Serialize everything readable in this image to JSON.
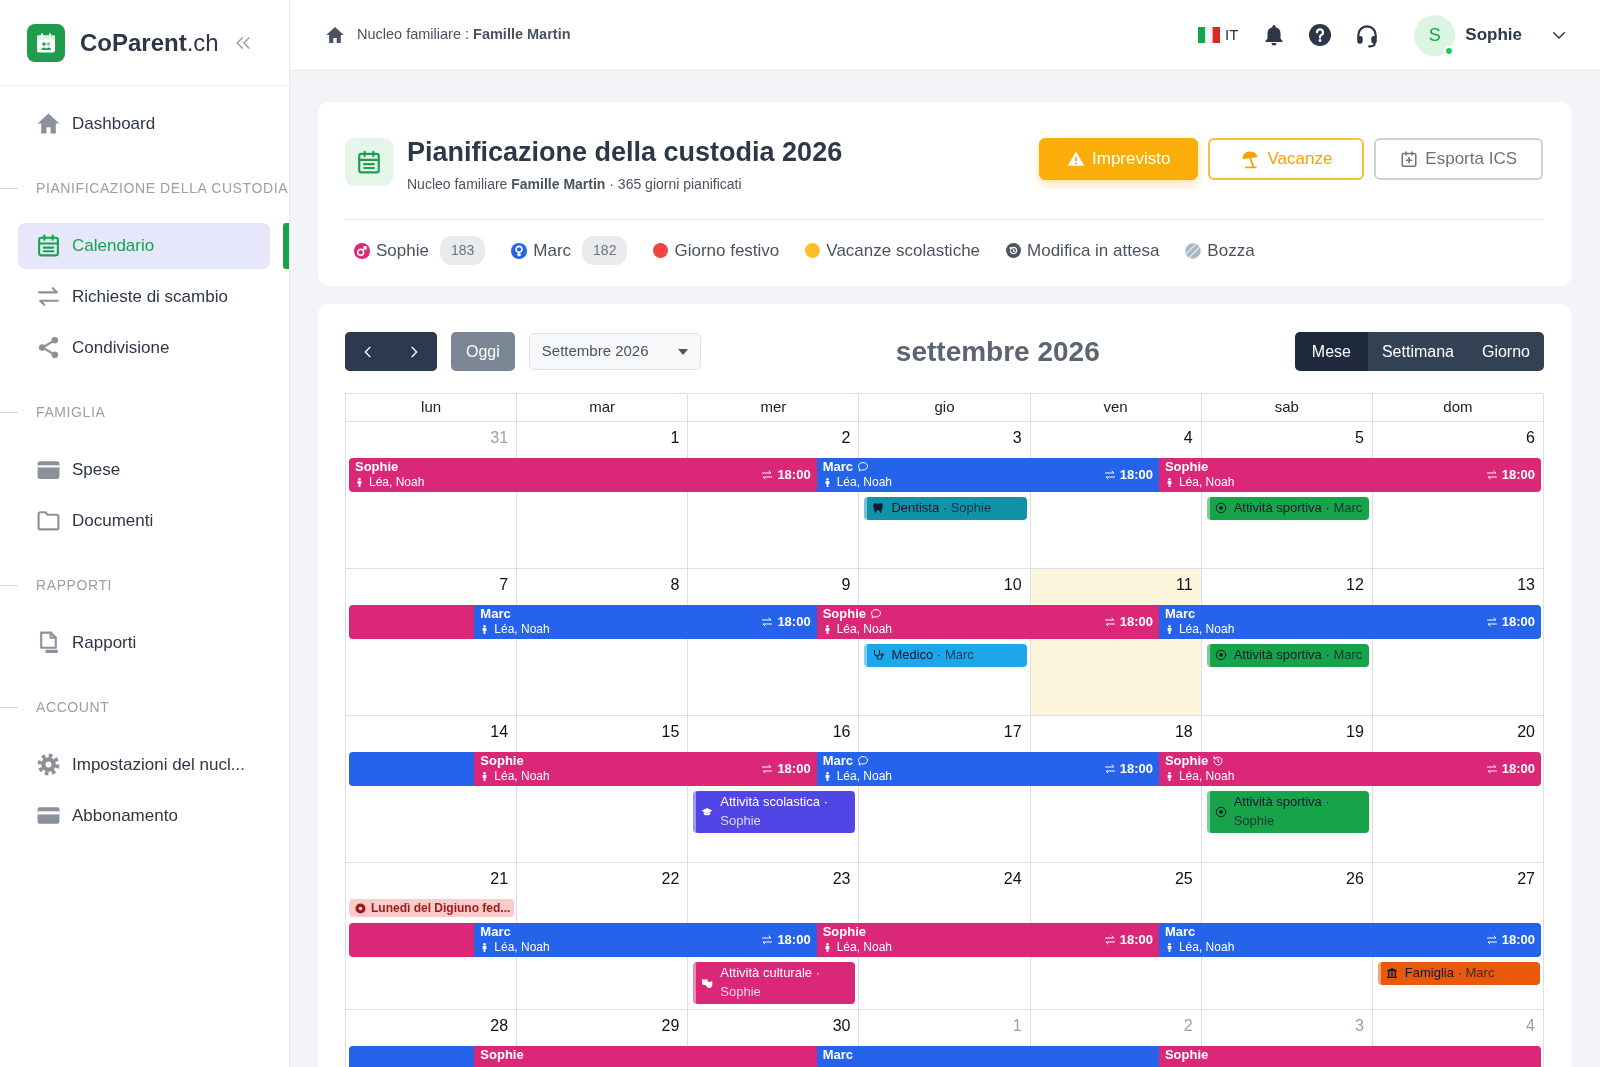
{
  "sidebar": {
    "brand": {
      "name": "CoParent",
      "suffix": ".ch"
    },
    "sections": [
      {
        "items": [
          {
            "label": "Dashboard",
            "selected": false
          }
        ]
      },
      {
        "heading": "PIANIFICAZIONE DELLA CUSTODIA",
        "items": [
          {
            "label": "Calendario",
            "selected": true
          },
          {
            "label": "Richieste di scambio",
            "selected": false
          },
          {
            "label": "Condivisione",
            "selected": false
          }
        ]
      },
      {
        "heading": "FAMIGLIA",
        "items": [
          {
            "label": "Spese",
            "selected": false
          },
          {
            "label": "Documenti",
            "selected": false
          }
        ]
      },
      {
        "heading": "RAPPORTI",
        "items": [
          {
            "label": "Rapporti",
            "selected": false
          }
        ]
      },
      {
        "heading": "ACCOUNT",
        "items": [
          {
            "label": "Impostazioni del nucl...",
            "selected": false
          },
          {
            "label": "Abbonamento",
            "selected": false
          }
        ]
      }
    ]
  },
  "topbar": {
    "breadcrumb": "Nucleo familiare : **Famille Martin**",
    "language": "IT",
    "user": {
      "initial": "S",
      "name": "Sophie",
      "online": true
    }
  },
  "header": {
    "title": "Pianificazione della custodia 2026",
    "subtitle": "Nucleo familiare **Famille Martin** · 365 giorni pianificati",
    "actions": [
      {
        "label": "Imprevisto",
        "kind": "warning"
      },
      {
        "label": "Vacanze",
        "kind": "outline-warning"
      },
      {
        "label": "Esporta ICS",
        "kind": "outline"
      }
    ],
    "legend": [
      {
        "label": "Sophie",
        "kind": "male",
        "color": "#db2777",
        "count": "183"
      },
      {
        "label": "Marc",
        "kind": "female",
        "color": "#2563eb",
        "count": "182"
      },
      {
        "label": "Giorno festivo",
        "kind": "dot",
        "color": "#ef4444"
      },
      {
        "label": "Vacanze scolastiche",
        "kind": "dot",
        "color": "#fbbf24"
      },
      {
        "label": "Modifica in attesa",
        "kind": "pending",
        "color": "#4b5563"
      },
      {
        "label": "Bozza",
        "kind": "draft",
        "color": "#a9b6c8"
      }
    ]
  },
  "calendar": {
    "month_picker": "Settembre 2026",
    "today_button": "Oggi",
    "title": "settembre 2026",
    "views": [
      {
        "label": "Mese",
        "selected": true
      },
      {
        "label": "Settimana",
        "selected": false
      },
      {
        "label": "Giorno",
        "selected": false
      }
    ],
    "weekdays": [
      "lun",
      "mar",
      "mer",
      "gio",
      "ven",
      "sab",
      "dom"
    ],
    "weeks": [
      {
        "carry": {
          "parent": "Sophie",
          "color": "#db2777",
          "children": "Léa, Noah",
          "time": "18:00",
          "note": false,
          "pending": false
        },
        "days": [
          {
            "date": "31",
            "outside": true,
            "today": false
          },
          {
            "date": "1",
            "outside": false,
            "today": false
          },
          {
            "date": "2",
            "outside": false,
            "today": false,
            "handover": {
              "parent": "Marc",
              "color": "#2563eb",
              "children": "Léa, Noah",
              "time": "18:00",
              "note": true,
              "pending": false
            }
          },
          {
            "date": "3",
            "outside": false,
            "today": false,
            "events": [
              {
                "kind": "dentist",
                "title": "Dentista ·",
                "person": "Sophie",
                "color": "#1192a9"
              }
            ]
          },
          {
            "date": "4",
            "outside": false,
            "today": false,
            "handover": {
              "parent": "Sophie",
              "color": "#db2777",
              "children": "Léa, Noah",
              "time": "18:00",
              "note": false,
              "pending": false
            }
          },
          {
            "date": "5",
            "outside": false,
            "today": false,
            "events": [
              {
                "kind": "sport",
                "title": "Attività sportiva ·",
                "person": "Marc",
                "color": "#16a34a"
              }
            ]
          },
          {
            "date": "6",
            "outside": false,
            "today": false
          }
        ]
      },
      {
        "carry": {
          "color": "#db2777"
        },
        "days": [
          {
            "date": "7",
            "outside": false,
            "today": false,
            "handover": {
              "parent": "Marc",
              "color": "#2563eb",
              "children": "Léa, Noah",
              "time": "18:00",
              "note": false,
              "pending": false
            }
          },
          {
            "date": "8",
            "outside": false,
            "today": false
          },
          {
            "date": "9",
            "outside": false,
            "today": false,
            "handover": {
              "parent": "Sophie",
              "color": "#db2777",
              "children": "Léa, Noah",
              "time": "18:00",
              "note": true,
              "pending": false
            }
          },
          {
            "date": "10",
            "outside": false,
            "today": false,
            "events": [
              {
                "kind": "medical",
                "title": "Medico ·",
                "person": "Marc",
                "color": "#1ba7e9"
              }
            ]
          },
          {
            "date": "11",
            "outside": false,
            "today": true,
            "handover": {
              "parent": "Marc",
              "color": "#2563eb",
              "children": "Léa, Noah",
              "time": "18:00",
              "note": false,
              "pending": false
            }
          },
          {
            "date": "12",
            "outside": false,
            "today": false,
            "events": [
              {
                "kind": "sport",
                "title": "Attività sportiva ·",
                "person": "Marc",
                "color": "#16a34a"
              }
            ]
          },
          {
            "date": "13",
            "outside": false,
            "today": false
          }
        ]
      },
      {
        "carry": {
          "color": "#2563eb"
        },
        "days": [
          {
            "date": "14",
            "outside": false,
            "today": false,
            "handover": {
              "parent": "Sophie",
              "color": "#db2777",
              "children": "Léa, Noah",
              "time": "18:00",
              "note": false,
              "pending": false
            }
          },
          {
            "date": "15",
            "outside": false,
            "today": false
          },
          {
            "date": "16",
            "outside": false,
            "today": false,
            "handover": {
              "parent": "Marc",
              "color": "#2563eb",
              "children": "Léa, Noah",
              "time": "18:00",
              "note": true,
              "pending": false
            },
            "events": [
              {
                "kind": "school",
                "title": "Attività scolastica ·",
                "person": "Sophie",
                "color": "#4f46e5"
              }
            ]
          },
          {
            "date": "17",
            "outside": false,
            "today": false
          },
          {
            "date": "18",
            "outside": false,
            "today": false,
            "handover": {
              "parent": "Sophie",
              "color": "#db2777",
              "children": "Léa, Noah",
              "time": "18:00",
              "note": false,
              "pending": true
            }
          },
          {
            "date": "19",
            "outside": false,
            "today": false,
            "events": [
              {
                "kind": "sport",
                "title": "Attività sportiva ·",
                "person": "Sophie",
                "color": "#16a34a"
              }
            ]
          },
          {
            "date": "20",
            "outside": false,
            "today": false
          }
        ]
      },
      {
        "carry": {
          "color": "#db2777"
        },
        "days": [
          {
            "date": "21",
            "outside": false,
            "today": false,
            "holiday": "Lunedì del Digiuno fed...",
            "handover": {
              "parent": "Marc",
              "color": "#2563eb",
              "children": "Léa, Noah",
              "time": "18:00",
              "note": false,
              "pending": false
            }
          },
          {
            "date": "22",
            "outside": false,
            "today": false
          },
          {
            "date": "23",
            "outside": false,
            "today": false,
            "handover": {
              "parent": "Sophie",
              "color": "#db2777",
              "children": "Léa, Noah",
              "time": "18:00",
              "note": false,
              "pending": false
            },
            "events": [
              {
                "kind": "culture",
                "title": "Attività culturale ·",
                "person": "Sophie",
                "color": "#db2777"
              }
            ]
          },
          {
            "date": "24",
            "outside": false,
            "today": false
          },
          {
            "date": "25",
            "outside": false,
            "today": false,
            "handover": {
              "parent": "Marc",
              "color": "#2563eb",
              "children": "Léa, Noah",
              "time": "18:00",
              "note": false,
              "pending": false
            }
          },
          {
            "date": "26",
            "outside": false,
            "today": false
          },
          {
            "date": "27",
            "outside": false,
            "today": false,
            "events": [
              {
                "kind": "family",
                "title": "Famiglia ·",
                "person": "Marc",
                "color": "#ea580c"
              }
            ]
          }
        ]
      },
      {
        "carry": {
          "color": "#2563eb"
        },
        "days": [
          {
            "date": "28",
            "outside": false,
            "today": false,
            "handover": {
              "parent": "Sophie",
              "color": "#db2777",
              "note": false,
              "pending": false
            }
          },
          {
            "date": "29",
            "outside": false,
            "today": false
          },
          {
            "date": "30",
            "outside": false,
            "today": false,
            "handover": {
              "parent": "Marc",
              "color": "#2563eb",
              "note": false,
              "pending": false
            }
          },
          {
            "date": "1",
            "outside": true,
            "today": false
          },
          {
            "date": "2",
            "outside": true,
            "today": false,
            "handover": {
              "parent": "Sophie",
              "color": "#db2777",
              "note": false,
              "pending": false
            }
          },
          {
            "date": "3",
            "outside": true,
            "today": false
          },
          {
            "date": "4",
            "outside": true,
            "today": false
          }
        ]
      }
    ]
  }
}
